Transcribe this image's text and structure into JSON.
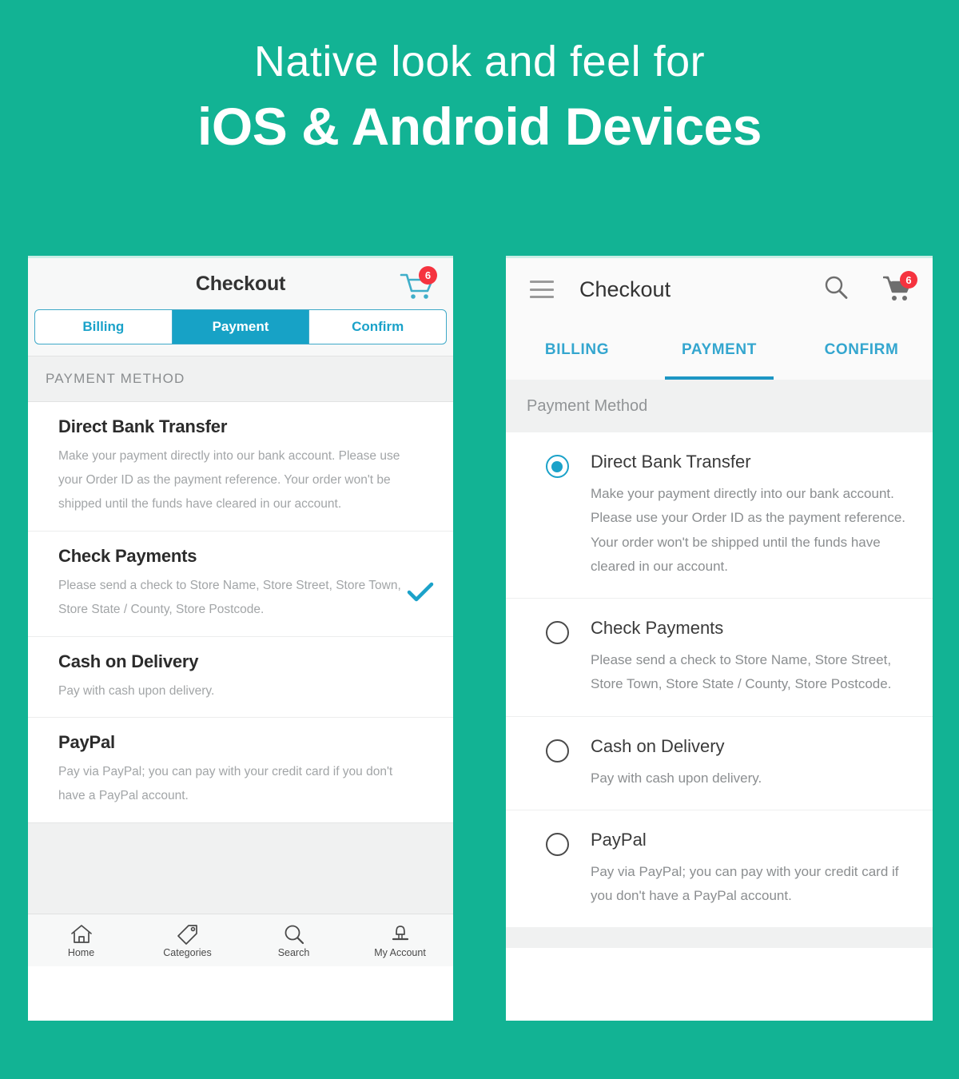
{
  "hero": {
    "line1": "Native look and feel for",
    "line2": "iOS & Android Devices"
  },
  "colors": {
    "background_teal": "#12b394",
    "accent_blue": "#17a2c6",
    "badge_red": "#f5333f",
    "section_gray": "#f0f1f1"
  },
  "ios": {
    "nav": {
      "title": "Checkout",
      "cart_icon": "shopping-cart-icon",
      "cart_badge": "6"
    },
    "segments": [
      {
        "label": "Billing",
        "active": false
      },
      {
        "label": "Payment",
        "active": true
      },
      {
        "label": "Confirm",
        "active": false
      }
    ],
    "section_header": "PAYMENT METHOD",
    "methods": [
      {
        "title": "Direct Bank Transfer",
        "desc": "Make your payment directly into our bank account. Please use your Order ID as the payment reference. Your order won't be shipped until the funds have cleared in our account.",
        "selected": false
      },
      {
        "title": "Check Payments",
        "desc": "Please send a check to Store Name, Store Street, Store Town, Store State / County, Store Postcode.",
        "selected": true
      },
      {
        "title": "Cash on Delivery",
        "desc": "Pay with cash upon delivery.",
        "selected": false
      },
      {
        "title": "PayPal",
        "desc": "Pay via PayPal; you can pay with your credit card if you don't have a PayPal account.",
        "selected": false
      }
    ],
    "tabbar": [
      {
        "label": "Home",
        "icon": "home-icon"
      },
      {
        "label": "Categories",
        "icon": "tag-icon"
      },
      {
        "label": "Search",
        "icon": "search-icon"
      },
      {
        "label": "My Account",
        "icon": "user-icon"
      }
    ]
  },
  "android": {
    "appbar": {
      "menu_icon": "hamburger-menu-icon",
      "title": "Checkout",
      "search_icon": "search-icon",
      "cart_icon": "shopping-cart-icon",
      "cart_badge": "6"
    },
    "tabs": [
      {
        "label": "BILLING",
        "active": false
      },
      {
        "label": "PAYMENT",
        "active": true
      },
      {
        "label": "CONFIRM",
        "active": false
      }
    ],
    "section_header": "Payment Method",
    "methods": [
      {
        "title": "Direct Bank Transfer",
        "desc": "Make your payment directly into our bank account. Please use your Order ID as the payment reference. Your order won't be shipped until the funds have cleared in our account.",
        "selected": true
      },
      {
        "title": "Check Payments",
        "desc": "Please send a check to Store Name, Store Street, Store Town, Store State / County, Store Postcode.",
        "selected": false
      },
      {
        "title": "Cash on Delivery",
        "desc": "Pay with cash upon delivery.",
        "selected": false
      },
      {
        "title": "PayPal",
        "desc": "Pay via PayPal; you can pay with your credit card if you don't have a PayPal account.",
        "selected": false
      }
    ]
  }
}
